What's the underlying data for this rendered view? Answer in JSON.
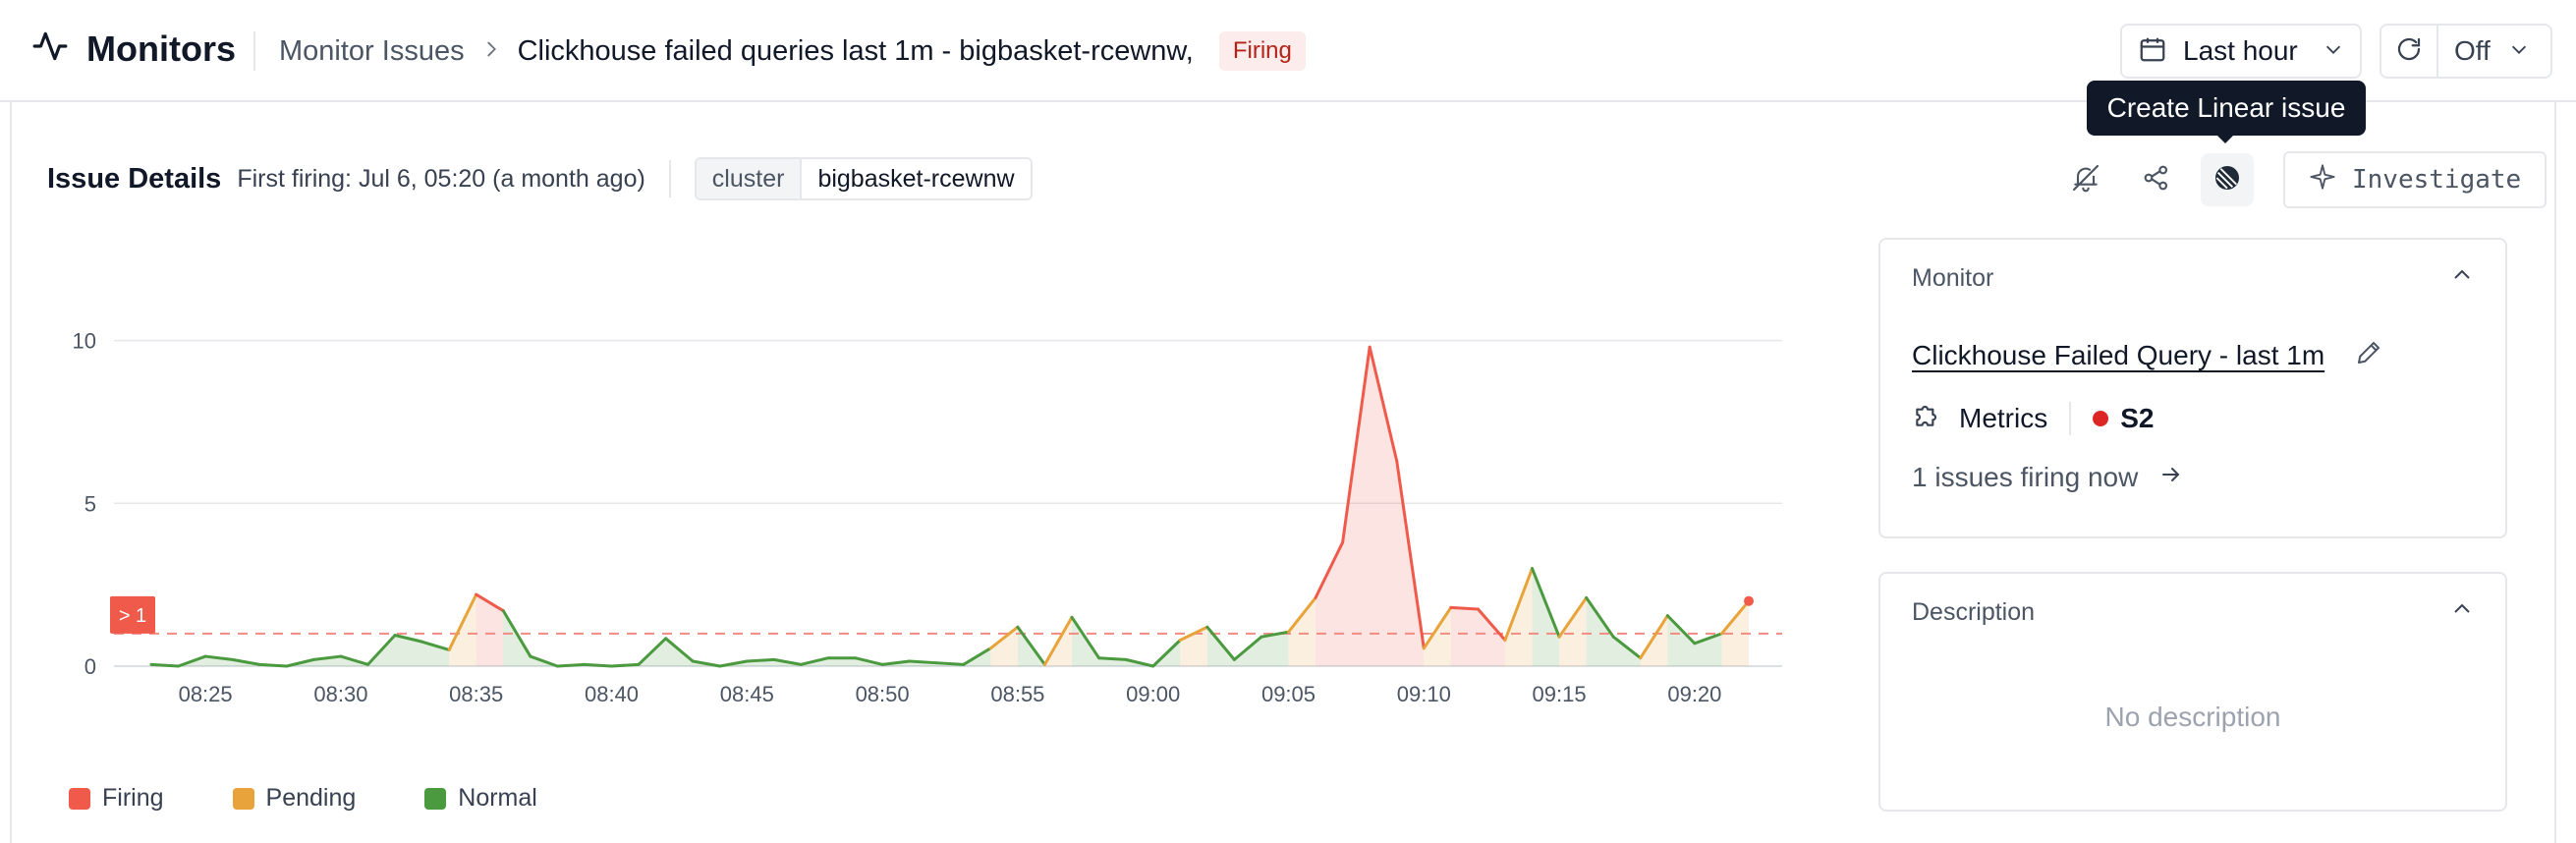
{
  "header": {
    "app_title": "Monitors",
    "breadcrumb_parent": "Monitor Issues",
    "breadcrumb_current": "Clickhouse failed queries last 1m - bigbasket-rcewnw,",
    "status_badge": "Firing",
    "time_range": "Last hour",
    "refresh_interval": "Off"
  },
  "tooltip": {
    "text": "Create Linear issue"
  },
  "issue": {
    "title": "Issue Details",
    "first_firing": "First firing: Jul 6, 05:20 (a month ago)",
    "tag_key": "cluster",
    "tag_value": "bigbasket-rcewnw",
    "investigate_label": "Investigate"
  },
  "monitor_panel": {
    "heading": "Monitor",
    "monitor_name": "Clickhouse Failed Query - last 1m",
    "type_label": "Metrics",
    "severity": "S2",
    "issues_firing": "1 issues firing now"
  },
  "description_panel": {
    "heading": "Description",
    "empty_text": "No description"
  },
  "colors": {
    "firing": "#ef5a4b",
    "pending": "#e8a33a",
    "normal": "#4b9a3f",
    "threshold": "#f28b82"
  },
  "icons": [
    "activity-icon",
    "chevron-right-icon",
    "calendar-icon",
    "chevron-down-icon",
    "refresh-icon",
    "bell-off-icon",
    "share-icon",
    "linear-icon",
    "sparkle-icon",
    "chevron-up-icon",
    "pencil-icon",
    "puzzle-icon",
    "arrow-right-icon"
  ],
  "chart_data": {
    "type": "line",
    "x_tick_labels": [
      "08:25",
      "08:30",
      "08:35",
      "08:40",
      "08:45",
      "08:50",
      "08:55",
      "09:00",
      "09:05",
      "09:10",
      "09:15",
      "09:20"
    ],
    "y_tick_labels": [
      "0",
      "5",
      "10"
    ],
    "ylim": [
      0,
      10.5
    ],
    "threshold": 1,
    "threshold_label": "> 1",
    "grid": true,
    "legend_position": "bottom-left",
    "legend": [
      "Firing",
      "Pending",
      "Normal"
    ],
    "x": [
      0,
      1,
      2,
      3,
      4,
      5,
      6,
      7,
      8,
      9,
      10,
      11,
      12,
      13,
      14,
      15,
      16,
      17,
      18,
      19,
      20,
      21,
      22,
      23,
      24,
      25,
      26,
      27,
      28,
      29,
      30,
      31,
      32,
      33,
      34,
      35,
      36,
      37,
      38,
      39,
      40,
      41,
      42,
      43,
      44,
      45,
      46,
      47,
      48,
      49,
      50,
      51,
      52,
      53,
      54,
      55,
      56,
      57,
      58,
      59
    ],
    "values": [
      0.05,
      0,
      0.3,
      0.2,
      0.05,
      0,
      0.2,
      0.3,
      0.05,
      0.95,
      0.75,
      0.5,
      2.2,
      1.7,
      0.3,
      0,
      0.05,
      0,
      0.05,
      0.85,
      0.15,
      0,
      0.15,
      0.2,
      0.05,
      0.25,
      0.25,
      0.05,
      0.15,
      0.1,
      0.05,
      0.55,
      1.2,
      0.05,
      1.5,
      0.25,
      0.2,
      0,
      0.8,
      1.2,
      0.2,
      0.9,
      1.05,
      2.1,
      3.8,
      9.8,
      6.3,
      0.55,
      1.8,
      1.75,
      0.8,
      3.0,
      0.9,
      2.1,
      0.9,
      0.25,
      1.55,
      0.7,
      1.0,
      2.0
    ],
    "states": [
      "normal",
      "normal",
      "normal",
      "normal",
      "normal",
      "normal",
      "normal",
      "normal",
      "normal",
      "normal",
      "normal",
      "normal",
      "pending",
      "firing",
      "normal",
      "normal",
      "normal",
      "normal",
      "normal",
      "normal",
      "normal",
      "normal",
      "normal",
      "normal",
      "normal",
      "normal",
      "normal",
      "normal",
      "normal",
      "normal",
      "normal",
      "normal",
      "pending",
      "normal",
      "pending",
      "normal",
      "normal",
      "normal",
      "normal",
      "pending",
      "normal",
      "normal",
      "normal",
      "pending",
      "firing",
      "firing",
      "firing",
      "firing",
      "pending",
      "firing",
      "firing",
      "pending",
      "normal",
      "pending",
      "normal",
      "normal",
      "pending",
      "normal",
      "normal",
      "pending"
    ]
  }
}
